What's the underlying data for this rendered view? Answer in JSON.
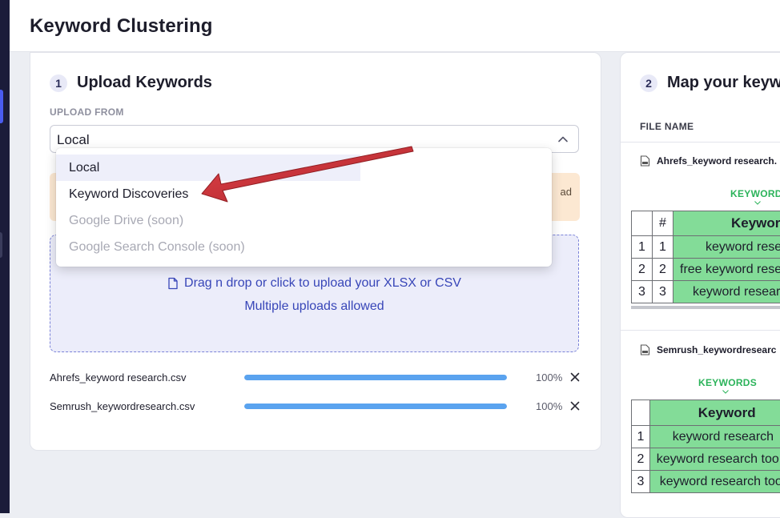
{
  "app": {
    "title": "Keyword Clustering"
  },
  "step1": {
    "number": "1",
    "title": "Upload Keywords",
    "upload_from_label": "UPLOAD FROM",
    "select_value": "Local",
    "dropdown_options": [
      {
        "label": "Local",
        "state": "selected"
      },
      {
        "label": "Keyword Discoveries",
        "state": "enabled"
      },
      {
        "label": "Google Drive (soon)",
        "state": "disabled"
      },
      {
        "label": "Google Search Console (soon)",
        "state": "disabled"
      }
    ],
    "notice_tail": "ad",
    "dropzone": {
      "line1": "Drag n drop or click to upload your XLSX or CSV",
      "line2": "Multiple uploads allowed"
    },
    "files": [
      {
        "name": "Ahrefs_keyword research.csv",
        "progress": 1.0,
        "percent": "100%"
      },
      {
        "name": "Semrush_keywordresearch.csv",
        "progress": 1.0,
        "percent": "100%"
      }
    ]
  },
  "step2": {
    "number": "2",
    "title": "Map your keyw",
    "file_name_header": "FILE NAME",
    "files": [
      {
        "name": "Ahrefs_keyword research.",
        "column_tag": "KEYWORDS",
        "headers": [
          "#",
          "Keyword"
        ],
        "rows": [
          {
            "row": "1",
            "num": "1",
            "keyword": "keyword rese"
          },
          {
            "row": "2",
            "num": "2",
            "keyword": "free keyword rese"
          },
          {
            "row": "3",
            "num": "3",
            "keyword": "keyword resear"
          }
        ]
      },
      {
        "name": "Semrush_keywordresearc",
        "column_tag": "KEYWORDS",
        "headers": [
          "Keyword"
        ],
        "rows": [
          {
            "row": "1",
            "keyword": "keyword research"
          },
          {
            "row": "2",
            "keyword": "keyword research too"
          },
          {
            "row": "3",
            "keyword": "keyword research too"
          }
        ]
      }
    ]
  },
  "colors": {
    "accent": "#3846b8",
    "annotation_arrow": "#c8262c",
    "keyword_green": "#83dc98",
    "progress_fill": "#5aa3ef"
  }
}
